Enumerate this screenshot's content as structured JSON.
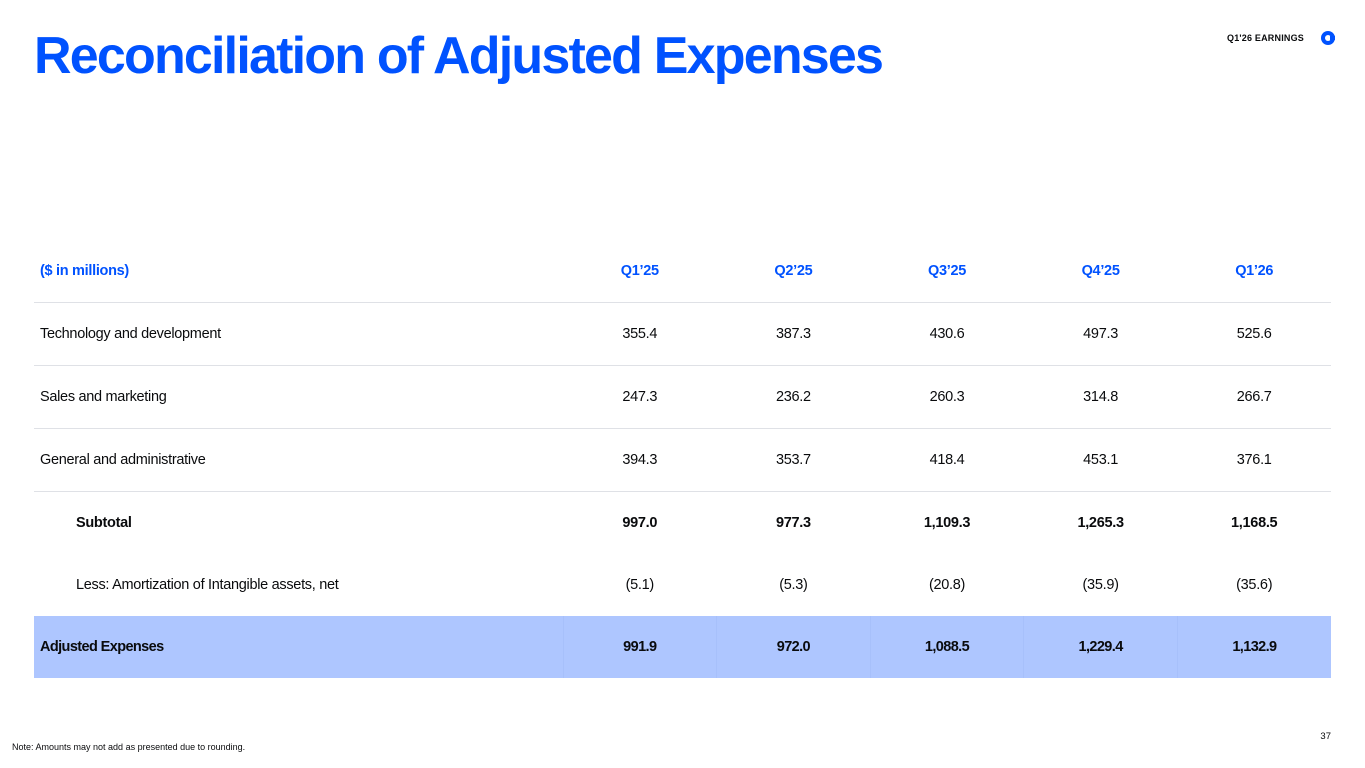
{
  "title": "Reconciliation of Adjusted Expenses",
  "header": {
    "earnings_label": "Q1'26 EARNINGS",
    "logo_icon": "coinbase-logo-icon"
  },
  "table": {
    "headers": [
      "($ in millions)",
      "Q1’25",
      "Q2’25",
      "Q3’25",
      "Q4’25",
      "Q1’26"
    ],
    "rows": [
      {
        "label": "Technology and development",
        "values": [
          "355.4",
          "387.3",
          "430.6",
          "497.3",
          "525.6"
        ]
      },
      {
        "label": "Sales and marketing",
        "values": [
          "247.3",
          "236.2",
          "260.3",
          "314.8",
          "266.7"
        ]
      },
      {
        "label": "General and administrative",
        "values": [
          "394.3",
          "353.7",
          "418.4",
          "453.1",
          "376.1"
        ]
      },
      {
        "label": "Subtotal",
        "values": [
          "997.0",
          "977.3",
          "1,109.3",
          "1,265.3",
          "1,168.5"
        ]
      },
      {
        "label": "Less: Amortization of Intangible assets, net",
        "values": [
          "(5.1)",
          "(5.3)",
          "(20.8)",
          "(35.9)",
          "(35.6)"
        ]
      },
      {
        "label": "Adjusted Expenses",
        "values": [
          "991.9",
          "972.0",
          "1,088.5",
          "1,229.4",
          "1,132.9"
        ]
      }
    ]
  },
  "footnote": "Note: Amounts may not add as presented due to rounding.",
  "page_number": "37",
  "colors": {
    "accent": "#0052ff",
    "highlight_row": "#aec6ff",
    "divider": "#dfe1e6"
  }
}
